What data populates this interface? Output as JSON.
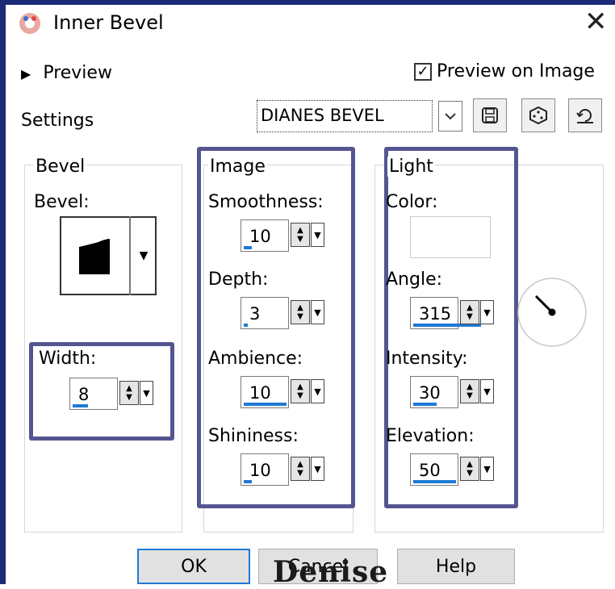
{
  "window": {
    "title": "Inner Bevel",
    "close_glyph": "✕"
  },
  "header": {
    "preview_arrow": "▶",
    "preview_label": "Preview",
    "preview_on_image_label": "Preview on Image",
    "preview_on_image_checked": true,
    "settings_label": "Settings",
    "preset_value": "DIANES BEVEL",
    "tool_icons": [
      "save-preset-icon",
      "randomize-dice-icon",
      "reset-defaults-icon"
    ]
  },
  "bevel_group": {
    "title": "Bevel",
    "bevel_label": "Bevel:",
    "width_label": "Width:",
    "width_value": "8",
    "width_fraction": 0.2
  },
  "image_group": {
    "title": "Image",
    "smoothness_label": "Smoothness:",
    "smoothness_value": "10",
    "smoothness_fraction": 0.1,
    "depth_label": "Depth:",
    "depth_value": "3",
    "depth_fraction": 0.05,
    "ambience_label": "Ambience:",
    "ambience_value": "10",
    "ambience_fraction": 0.55,
    "shininess_label": "Shininess:",
    "shininess_value": "10",
    "shininess_fraction": 0.1
  },
  "light_group": {
    "title": "Light",
    "color_label": "Color:",
    "color_value": "#ffffff",
    "angle_label": "Angle:",
    "angle_value": "315",
    "angle_fraction": 0.875,
    "intensity_label": "Intensity:",
    "intensity_value": "30",
    "intensity_fraction": 0.3,
    "elevation_label": "Elevation:",
    "elevation_value": "50",
    "elevation_fraction": 0.55
  },
  "footer": {
    "ok_label": "OK",
    "cancel_label": "Cancel",
    "help_label": "Help"
  },
  "watermark_text": "Denise",
  "colors": {
    "highlight_border": "#555590",
    "accent_blue": "#1e7ad4",
    "window_frame": "#1c2a78"
  }
}
